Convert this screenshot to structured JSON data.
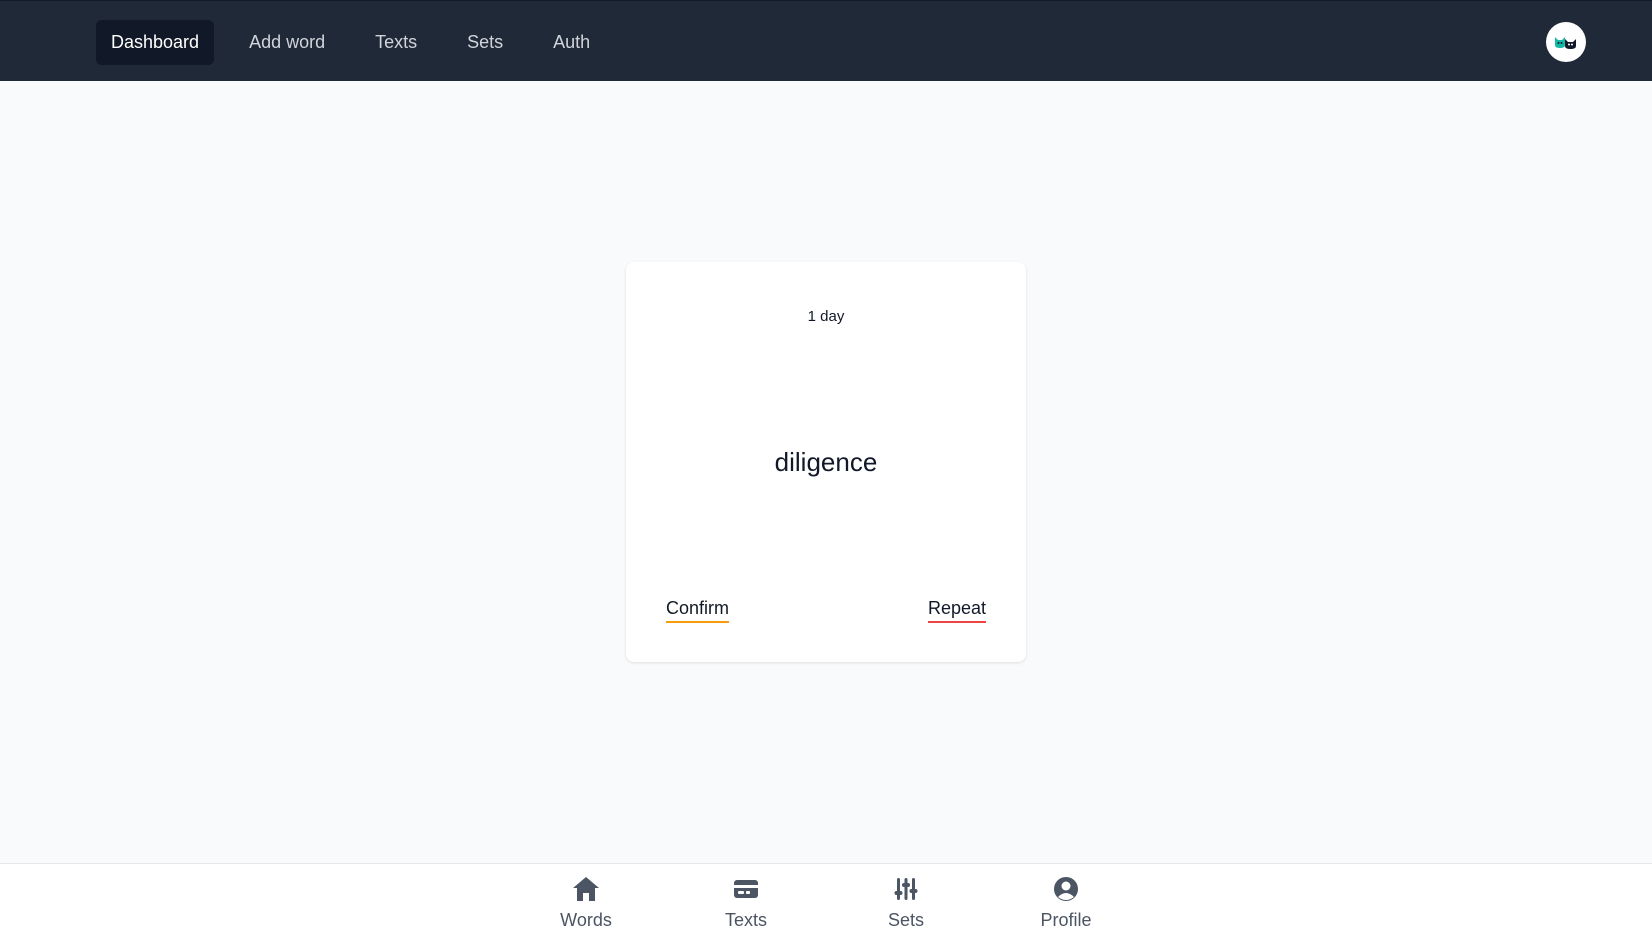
{
  "topnav": {
    "items": [
      {
        "label": "Dashboard",
        "active": true
      },
      {
        "label": "Add word"
      },
      {
        "label": "Texts"
      },
      {
        "label": "Sets"
      },
      {
        "label": "Auth"
      }
    ],
    "avatar_icon": "cat-icon"
  },
  "card": {
    "interval": "1 day",
    "word": "diligence",
    "confirm_label": "Confirm",
    "repeat_label": "Repeat",
    "confirm_color": "#f59e0b",
    "repeat_color": "#ef4444"
  },
  "bottomnav": {
    "items": [
      {
        "label": "Words",
        "icon": "home-icon"
      },
      {
        "label": "Texts",
        "icon": "card-icon"
      },
      {
        "label": "Sets",
        "icon": "sliders-icon"
      },
      {
        "label": "Profile",
        "icon": "user-circle-icon"
      }
    ]
  },
  "colors": {
    "topbar": "#1f2937",
    "active_nav": "#111827",
    "background": "#f9fafb"
  }
}
